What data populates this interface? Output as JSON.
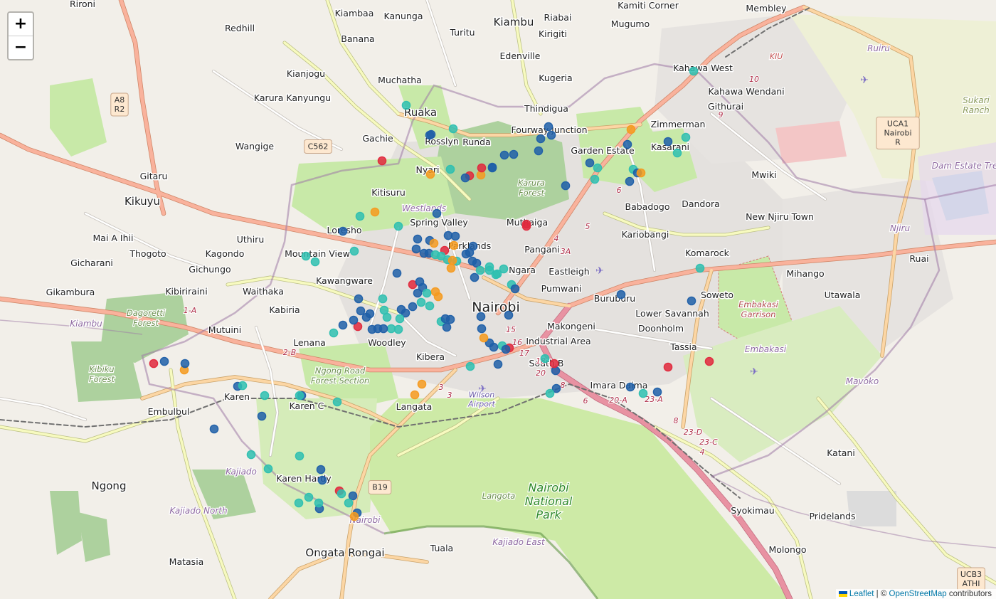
{
  "controls": {
    "zoom_in": "+",
    "zoom_out": "−"
  },
  "attribution": {
    "leaflet": "Leaflet",
    "separator": "| ©",
    "osm": "OpenStreetMap",
    "suffix": "contributors"
  },
  "colors": {
    "land": "#f2efe9",
    "residential": "#e0dfdf",
    "park": "#c8e9a8",
    "forest": "#add19e",
    "national_park": "#cdeaa6",
    "water": "#aad3df",
    "motorway": "#e892a2",
    "trunk": "#f9b29c",
    "primary": "#fcd6a4",
    "secondary": "#f7fabf",
    "boundary": "#9e7aa6",
    "protected": "#5f9445",
    "railway": "#707070",
    "label": "#222222",
    "marker_blue": "#1f5fa8",
    "marker_teal": "#2ebfb0",
    "marker_orange": "#f59a1e",
    "marker_red": "#e0283c"
  },
  "places": [
    {
      "name": "Rironi",
      "cls": "s"
    },
    {
      "name": "Kiambaa",
      "cls": "s"
    },
    {
      "name": "Kanunga",
      "cls": "s"
    },
    {
      "name": "Kiambu",
      "cls": "m"
    },
    {
      "name": "Riabai",
      "cls": "s"
    },
    {
      "name": "Mugumo",
      "cls": "s"
    },
    {
      "name": "Kamiti Corner",
      "cls": "s"
    },
    {
      "name": "Membley",
      "cls": "s"
    },
    {
      "name": "Redhill",
      "cls": "s"
    },
    {
      "name": "Turitu",
      "cls": "s"
    },
    {
      "name": "Kirigiti",
      "cls": "s"
    },
    {
      "name": "Banana",
      "cls": "s"
    },
    {
      "name": "Edenville",
      "cls": "s"
    },
    {
      "name": "Kianjogu",
      "cls": "s"
    },
    {
      "name": "Muchatha",
      "cls": "s"
    },
    {
      "name": "Kugeria",
      "cls": "s"
    },
    {
      "name": "Kahawa West",
      "cls": "s"
    },
    {
      "name": "Kahawa Wendani",
      "cls": "s"
    },
    {
      "name": "Karura Kanyungu",
      "cls": "s"
    },
    {
      "name": "Githurai",
      "cls": "s"
    },
    {
      "name": "Ruaka",
      "cls": "m"
    },
    {
      "name": "Thindigua",
      "cls": "s"
    },
    {
      "name": "Fourway Junction",
      "cls": "s"
    },
    {
      "name": "Zimmerman",
      "cls": "s"
    },
    {
      "name": "Gachie",
      "cls": "s"
    },
    {
      "name": "Wangige",
      "cls": "s"
    },
    {
      "name": "Rosslyn",
      "cls": "s"
    },
    {
      "name": "Runda",
      "cls": "s"
    },
    {
      "name": "Garden Estate",
      "cls": "s"
    },
    {
      "name": "Kasarani",
      "cls": "s"
    },
    {
      "name": "Gitaru",
      "cls": "s"
    },
    {
      "name": "Nyari",
      "cls": "s"
    },
    {
      "name": "Mwiki",
      "cls": "s"
    },
    {
      "name": "Kitisuru",
      "cls": "s"
    },
    {
      "name": "Kikuyu",
      "cls": "m"
    },
    {
      "name": "Babadogo",
      "cls": "s"
    },
    {
      "name": "Dandora",
      "cls": "s"
    },
    {
      "name": "Spring Valley",
      "cls": "s"
    },
    {
      "name": "Muthaiga",
      "cls": "s"
    },
    {
      "name": "Mai A Ihii",
      "cls": "s"
    },
    {
      "name": "Uthiru",
      "cls": "s"
    },
    {
      "name": "Loresho",
      "cls": "s"
    },
    {
      "name": "Kariobangi",
      "cls": "s"
    },
    {
      "name": "New Njiru Town",
      "cls": "s"
    },
    {
      "name": "Parklands",
      "cls": "s"
    },
    {
      "name": "Thogoto",
      "cls": "s"
    },
    {
      "name": "Kagondo",
      "cls": "s"
    },
    {
      "name": "Mountain View",
      "cls": "s"
    },
    {
      "name": "Pangani",
      "cls": "s"
    },
    {
      "name": "Komarock",
      "cls": "s"
    },
    {
      "name": "Gicharani",
      "cls": "s"
    },
    {
      "name": "Gichungo",
      "cls": "s"
    },
    {
      "name": "Ngara",
      "cls": "s"
    },
    {
      "name": "Eastleigh",
      "cls": "s"
    },
    {
      "name": "Ruai",
      "cls": "s"
    },
    {
      "name": "Kawangware",
      "cls": "s"
    },
    {
      "name": "Mihango",
      "cls": "s"
    },
    {
      "name": "Gikambura",
      "cls": "s"
    },
    {
      "name": "Kibiriraini",
      "cls": "s"
    },
    {
      "name": "Waithaka",
      "cls": "s"
    },
    {
      "name": "Pumwani",
      "cls": "s"
    },
    {
      "name": "Buruburu",
      "cls": "s"
    },
    {
      "name": "Soweto",
      "cls": "s"
    },
    {
      "name": "Utawala",
      "cls": "s"
    },
    {
      "name": "Kabiria",
      "cls": "s"
    },
    {
      "name": "Nairobi",
      "cls": "l"
    },
    {
      "name": "Lower Savannah",
      "cls": "s"
    },
    {
      "name": "Mutuini",
      "cls": "s"
    },
    {
      "name": "Makongeni",
      "cls": "s"
    },
    {
      "name": "Doonholm",
      "cls": "s"
    },
    {
      "name": "Industrial Area",
      "cls": "s"
    },
    {
      "name": "Lenana",
      "cls": "s"
    },
    {
      "name": "Woodley",
      "cls": "s"
    },
    {
      "name": "Tassia",
      "cls": "s"
    },
    {
      "name": "Kibera",
      "cls": "s"
    },
    {
      "name": "South B",
      "cls": "s"
    },
    {
      "name": "Imara Daima",
      "cls": "s"
    },
    {
      "name": "Karen",
      "cls": "s"
    },
    {
      "name": "Karen C",
      "cls": "s"
    },
    {
      "name": "Langata",
      "cls": "s"
    },
    {
      "name": "Embulbul",
      "cls": "s"
    },
    {
      "name": "Katani",
      "cls": "s"
    },
    {
      "name": "Ngong",
      "cls": "m"
    },
    {
      "name": "Karen Hardy",
      "cls": "s"
    },
    {
      "name": "Syokimau",
      "cls": "s"
    },
    {
      "name": "Pridelands",
      "cls": "s"
    },
    {
      "name": "Ongata Rongai",
      "cls": "m"
    },
    {
      "name": "Tuala",
      "cls": "s"
    },
    {
      "name": "Molongo",
      "cls": "s"
    },
    {
      "name": "Matasia",
      "cls": "s"
    }
  ],
  "areas": [
    {
      "name": "Karura Forest",
      "cls": "f"
    },
    {
      "name": "Dagoretti Forest",
      "cls": "f"
    },
    {
      "name": "Kibiku Forest",
      "cls": "f"
    },
    {
      "name": "Ngong Road Forest Section",
      "cls": "f"
    },
    {
      "name": "Nairobi National Park",
      "cls": "np"
    },
    {
      "name": "Langota",
      "cls": "f"
    },
    {
      "name": "Embakasi Garrison",
      "cls": "mil"
    },
    {
      "name": "Sukari Ranch",
      "cls": "r"
    },
    {
      "name": "Wilson Airport",
      "cls": "ap"
    },
    {
      "name": "Westlands",
      "cls": "adm"
    },
    {
      "name": "Kiambu",
      "cls": "adm"
    },
    {
      "name": "Ruiru",
      "cls": "adm"
    },
    {
      "name": "Kajiado North",
      "cls": "adm"
    },
    {
      "name": "Kajiado",
      "cls": "adm"
    },
    {
      "name": "Kajiado East",
      "cls": "adm"
    },
    {
      "name": "Nairobi",
      "cls": "adm"
    },
    {
      "name": "Njiru",
      "cls": "adm"
    },
    {
      "name": "Embakasi",
      "cls": "adm"
    },
    {
      "name": "Mavoko",
      "cls": "adm"
    },
    {
      "name": "KIU",
      "cls": "red"
    },
    {
      "name": "Dam Estate Treatm Plant",
      "cls": "adm"
    }
  ],
  "road_refs": [
    "C562",
    "B19",
    "A8 R2",
    "UCA1 Nairobi R",
    "UCB3 ATHI"
  ],
  "road_numbers": [
    "1-A",
    "2-B",
    "3",
    "3",
    "3A",
    "4",
    "5",
    "6",
    "10",
    "9",
    "15",
    "16",
    "17",
    "18",
    "8",
    "20",
    "20-A",
    "23-A",
    "23-D",
    "23-C",
    "4",
    "8",
    "6"
  ],
  "markers": [
    {
      "c": "teal"
    },
    {
      "c": "blue"
    },
    {
      "c": "blue"
    },
    {
      "c": "teal"
    },
    {
      "c": "red"
    },
    {
      "c": "orange"
    },
    {
      "c": "teal"
    },
    {
      "c": "red"
    },
    {
      "c": "blue"
    },
    {
      "c": "blue"
    },
    {
      "c": "orange"
    },
    {
      "c": "red"
    },
    {
      "c": "blue"
    },
    {
      "c": "blue"
    },
    {
      "c": "blue"
    },
    {
      "c": "blue"
    },
    {
      "c": "blue"
    },
    {
      "c": "blue"
    },
    {
      "c": "blue"
    },
    {
      "c": "blue"
    },
    {
      "c": "blue"
    },
    {
      "c": "teal"
    },
    {
      "c": "teal"
    },
    {
      "c": "teal"
    },
    {
      "c": "blue"
    },
    {
      "c": "blue"
    },
    {
      "c": "orange"
    },
    {
      "c": "blue"
    },
    {
      "c": "orange"
    },
    {
      "c": "teal"
    },
    {
      "c": "blue"
    },
    {
      "c": "teal"
    },
    {
      "c": "teal"
    },
    {
      "c": "red"
    },
    {
      "c": "orange"
    },
    {
      "c": "teal"
    },
    {
      "c": "teal"
    },
    {
      "c": "blue"
    },
    {
      "c": "blue"
    },
    {
      "c": "blue"
    },
    {
      "c": "blue"
    },
    {
      "c": "orange"
    },
    {
      "c": "orange"
    },
    {
      "c": "red"
    },
    {
      "c": "blue"
    },
    {
      "c": "blue"
    },
    {
      "c": "blue"
    },
    {
      "c": "teal"
    },
    {
      "c": "teal"
    },
    {
      "c": "teal"
    },
    {
      "c": "blue"
    },
    {
      "c": "blue"
    },
    {
      "c": "blue"
    },
    {
      "c": "teal"
    },
    {
      "c": "teal"
    },
    {
      "c": "teal"
    },
    {
      "c": "teal"
    },
    {
      "c": "blue"
    },
    {
      "c": "orange"
    },
    {
      "c": "orange"
    },
    {
      "c": "blue"
    },
    {
      "c": "blue"
    },
    {
      "c": "blue"
    },
    {
      "c": "teal"
    },
    {
      "c": "teal"
    },
    {
      "c": "teal"
    },
    {
      "c": "teal"
    },
    {
      "c": "red"
    },
    {
      "c": "blue"
    },
    {
      "c": "blue"
    },
    {
      "c": "blue"
    },
    {
      "c": "blue"
    },
    {
      "c": "orange"
    },
    {
      "c": "orange"
    },
    {
      "c": "blue"
    },
    {
      "c": "blue"
    },
    {
      "c": "blue"
    },
    {
      "c": "blue"
    },
    {
      "c": "blue"
    },
    {
      "c": "teal"
    },
    {
      "c": "teal"
    },
    {
      "c": "teal"
    },
    {
      "c": "blue"
    },
    {
      "c": "blue"
    },
    {
      "c": "red"
    },
    {
      "c": "blue"
    },
    {
      "c": "blue"
    },
    {
      "c": "teal"
    },
    {
      "c": "teal"
    },
    {
      "c": "teal"
    },
    {
      "c": "teal"
    },
    {
      "c": "blue"
    },
    {
      "c": "blue"
    },
    {
      "c": "blue"
    },
    {
      "c": "teal"
    },
    {
      "c": "teal"
    },
    {
      "c": "teal"
    },
    {
      "c": "teal"
    },
    {
      "c": "blue"
    },
    {
      "c": "blue"
    },
    {
      "c": "blue"
    },
    {
      "c": "teal"
    },
    {
      "c": "teal"
    },
    {
      "c": "blue"
    },
    {
      "c": "teal"
    },
    {
      "c": "blue"
    },
    {
      "c": "red"
    },
    {
      "c": "blue"
    },
    {
      "c": "blue"
    },
    {
      "c": "blue"
    },
    {
      "c": "teal"
    },
    {
      "c": "red"
    },
    {
      "c": "blue"
    },
    {
      "c": "blue"
    },
    {
      "c": "blue"
    },
    {
      "c": "teal"
    },
    {
      "c": "orange"
    },
    {
      "c": "blue"
    },
    {
      "c": "teal"
    },
    {
      "c": "blue"
    },
    {
      "c": "red"
    },
    {
      "c": "blue"
    },
    {
      "c": "teal"
    },
    {
      "c": "orange"
    },
    {
      "c": "orange"
    },
    {
      "c": "blue"
    },
    {
      "c": "teal"
    },
    {
      "c": "blue"
    },
    {
      "c": "red"
    },
    {
      "c": "red"
    },
    {
      "c": "blue"
    },
    {
      "c": "teal"
    },
    {
      "c": "blue"
    },
    {
      "c": "red"
    },
    {
      "c": "blue"
    },
    {
      "c": "orange"
    },
    {
      "c": "blue"
    },
    {
      "c": "blue"
    },
    {
      "c": "teal"
    },
    {
      "c": "teal"
    },
    {
      "c": "blue"
    },
    {
      "c": "teal"
    },
    {
      "c": "teal"
    },
    {
      "c": "blue"
    },
    {
      "c": "blue"
    },
    {
      "c": "teal"
    },
    {
      "c": "teal"
    },
    {
      "c": "teal"
    },
    {
      "c": "blue"
    },
    {
      "c": "blue"
    },
    {
      "c": "teal"
    },
    {
      "c": "red"
    },
    {
      "c": "teal"
    },
    {
      "c": "blue"
    },
    {
      "c": "teal"
    },
    {
      "c": "blue"
    },
    {
      "c": "orange"
    },
    {
      "c": "teal"
    },
    {
      "c": "blue"
    },
    {
      "c": "teal"
    },
    {
      "c": "teal"
    },
    {
      "c": "blue"
    },
    {
      "c": "orange"
    },
    {
      "c": "blue"
    }
  ]
}
